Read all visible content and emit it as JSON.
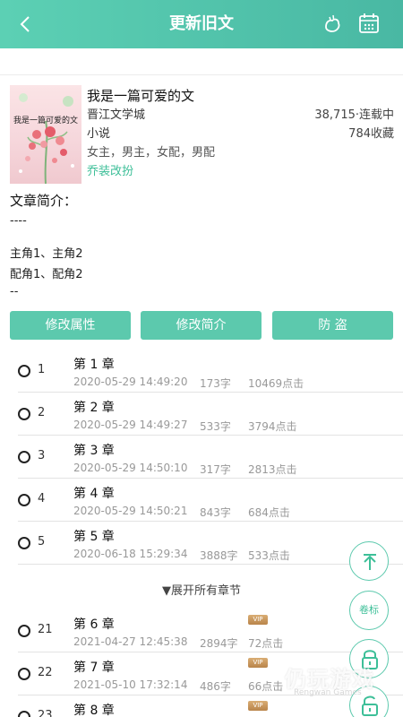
{
  "header": {
    "title": "更新旧文",
    "back_icon": "chevron-left-icon",
    "icons": [
      "water-drop-icon",
      "calendar-icon"
    ],
    "color": "#52c4ab"
  },
  "book": {
    "cover_title": "我是一篇可爱的文",
    "title": "我是一篇可爱的文",
    "site": "晋江文学城",
    "stats": "38,715·连载中",
    "category": "小说",
    "favorites": "784收藏",
    "tags": "女主，男主，女配，男配",
    "style_link": "乔装改扮"
  },
  "intro": {
    "heading": "文章简介：",
    "lines": [
      "----",
      "主角1、主角2",
      "配角1、配角2",
      "--"
    ]
  },
  "actions": [
    "修改属性",
    "修改简介",
    "防 盗"
  ],
  "chapters": [
    {
      "index": "1",
      "name": "第 1 章",
      "date": "2020-05-29 14:49:20",
      "words": "173字",
      "clicks": "10469点击",
      "vip": false
    },
    {
      "index": "2",
      "name": "第 2 章",
      "date": "2020-05-29 14:49:27",
      "words": "533字",
      "clicks": "3794点击",
      "vip": false
    },
    {
      "index": "3",
      "name": "第 3 章",
      "date": "2020-05-29 14:50:10",
      "words": "317字",
      "clicks": "2813点击",
      "vip": false
    },
    {
      "index": "4",
      "name": "第 4 章",
      "date": "2020-05-29 14:50:21",
      "words": "843字",
      "clicks": "684点击",
      "vip": false
    },
    {
      "index": "5",
      "name": "第 5 章",
      "date": "2020-06-18 15:29:34",
      "words": "3888字",
      "clicks": "533点击",
      "vip": false
    }
  ],
  "expand_label": "▼展开所有章节",
  "vip_chapters": [
    {
      "index": "21",
      "name": "第 6 章",
      "date": "2021-04-27 12:45:38",
      "words": "2894字",
      "clicks": "72点击",
      "vip": true
    },
    {
      "index": "22",
      "name": "第 7 章",
      "date": "2021-05-10 17:32:14",
      "words": "486字",
      "clicks": "66点击",
      "vip": true
    },
    {
      "index": "23",
      "name": "第 8 章",
      "date": "",
      "words": "",
      "clicks": "",
      "vip": true
    }
  ],
  "vip_badge": "VIP",
  "floating": {
    "top_icon": "arrow-up-icon",
    "volume_label": "卷标",
    "lock_icon": "lock-icon",
    "unlock_icon": "unlock-icon"
  },
  "watermark": {
    "text": "仍玩游戏",
    "sub": "Rengwan Games"
  }
}
